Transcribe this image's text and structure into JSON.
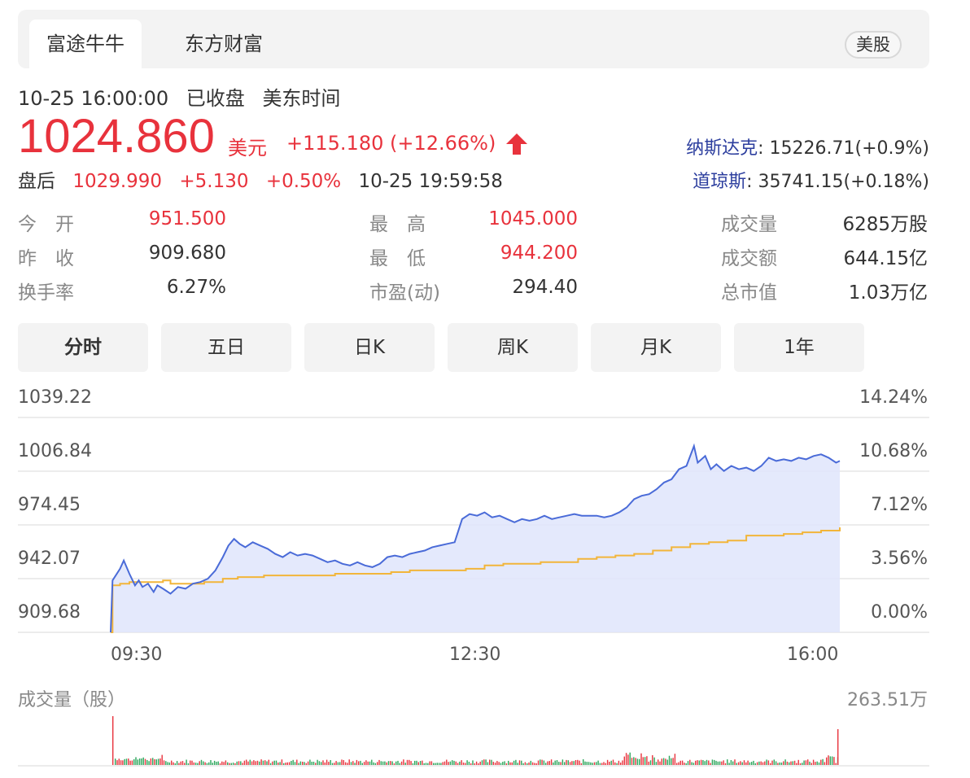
{
  "source_tabs": [
    "富途牛牛",
    "东方财富"
  ],
  "market_badge": "美股",
  "timestamp": "10-25 16:00:00",
  "status": "已收盘",
  "timezone": "美东时间",
  "price": "1024.860",
  "currency": "美元",
  "change": "+115.180 (+12.66%)",
  "indices": [
    {
      "name": "纳斯达克",
      "value": ": 15226.71(+0.9%)"
    },
    {
      "name": "道琼斯",
      "value": ": 35741.15(+0.18%)"
    }
  ],
  "after_hours": {
    "label": "盘后",
    "price": "1029.990",
    "change": "+5.130",
    "percent": "+0.50%",
    "time": "10-25 19:59:58"
  },
  "stats": [
    {
      "label": "今　开",
      "value": "951.500",
      "red": true
    },
    {
      "label": "最　高",
      "value": "1045.000",
      "red": true
    },
    {
      "label": "成交量",
      "value": "6285万股",
      "red": false
    },
    {
      "label": "昨　收",
      "value": "909.680",
      "red": false
    },
    {
      "label": "最　低",
      "value": "944.200",
      "red": true
    },
    {
      "label": "成交额",
      "value": "644.15亿",
      "red": false
    },
    {
      "label": "换手率",
      "value": "6.27%",
      "red": false
    },
    {
      "label": "市盈(动)",
      "value": "294.40",
      "red": false
    },
    {
      "label": "总市值",
      "value": "1.03万亿",
      "red": false
    }
  ],
  "period_tabs": [
    "分时",
    "五日",
    "日K",
    "周K",
    "月K",
    "1年"
  ],
  "active_period": "分时",
  "colors": {
    "up": "#e8323c",
    "down": "#2aa55a",
    "price_line": "#4a6bd8",
    "avg_line": "#f2b53a",
    "fill": "#dfe5fb"
  },
  "chart_data": {
    "type": "line",
    "title": "",
    "y_left_ticks": [
      "1039.22",
      "1006.84",
      "974.45",
      "942.07",
      "909.68"
    ],
    "y_right_ticks": [
      "14.24%",
      "10.68%",
      "7.12%",
      "3.56%",
      "0.00%"
    ],
    "x_ticks": [
      "09:30",
      "12:30",
      "16:00"
    ],
    "ylim": [
      909.68,
      1039.22
    ],
    "x_range_minutes": [
      0,
      390
    ],
    "series": [
      {
        "values": [
          [
            0,
            909.68
          ],
          [
            1,
            941
          ],
          [
            5,
            948
          ],
          [
            7,
            953
          ],
          [
            10,
            945
          ],
          [
            13,
            938
          ],
          [
            15,
            941
          ],
          [
            17,
            937
          ],
          [
            20,
            939
          ],
          [
            23,
            934
          ],
          [
            25,
            938
          ],
          [
            28,
            936
          ],
          [
            32,
            933
          ],
          [
            36,
            937
          ],
          [
            40,
            936
          ],
          [
            44,
            939
          ],
          [
            48,
            940
          ],
          [
            52,
            942
          ],
          [
            56,
            947
          ],
          [
            60,
            955
          ],
          [
            63,
            962
          ],
          [
            66,
            966
          ],
          [
            69,
            963
          ],
          [
            72,
            961
          ],
          [
            76,
            964
          ],
          [
            80,
            962
          ],
          [
            84,
            960
          ],
          [
            88,
            957
          ],
          [
            92,
            955
          ],
          [
            96,
            958
          ],
          [
            100,
            956
          ],
          [
            104,
            957
          ],
          [
            108,
            956
          ],
          [
            112,
            954
          ],
          [
            116,
            952
          ],
          [
            120,
            953
          ],
          [
            124,
            951
          ],
          [
            128,
            950
          ],
          [
            132,
            952
          ],
          [
            136,
            950
          ],
          [
            140,
            949
          ],
          [
            144,
            951
          ],
          [
            148,
            955
          ],
          [
            152,
            956
          ],
          [
            156,
            955
          ],
          [
            160,
            957
          ],
          [
            164,
            958
          ],
          [
            168,
            959
          ],
          [
            172,
            961
          ],
          [
            176,
            962
          ],
          [
            180,
            963
          ],
          [
            184,
            964
          ],
          [
            188,
            978
          ],
          [
            192,
            981
          ],
          [
            196,
            980
          ],
          [
            200,
            982
          ],
          [
            204,
            979
          ],
          [
            208,
            980
          ],
          [
            212,
            978
          ],
          [
            216,
            976
          ],
          [
            220,
            978
          ],
          [
            224,
            977
          ],
          [
            228,
            978
          ],
          [
            232,
            980
          ],
          [
            236,
            978
          ],
          [
            240,
            979
          ],
          [
            244,
            980
          ],
          [
            248,
            981
          ],
          [
            252,
            980
          ],
          [
            256,
            980
          ],
          [
            260,
            980
          ],
          [
            264,
            979
          ],
          [
            268,
            980
          ],
          [
            272,
            982
          ],
          [
            276,
            985
          ],
          [
            280,
            990
          ],
          [
            284,
            992
          ],
          [
            288,
            993
          ],
          [
            292,
            996
          ],
          [
            296,
            1000
          ],
          [
            300,
            1002
          ],
          [
            304,
            1008
          ],
          [
            308,
            1010
          ],
          [
            312,
            1022
          ],
          [
            314,
            1012
          ],
          [
            318,
            1016
          ],
          [
            321,
            1008
          ],
          [
            324,
            1011
          ],
          [
            328,
            1007
          ],
          [
            332,
            1010
          ],
          [
            336,
            1008
          ],
          [
            340,
            1009
          ],
          [
            344,
            1007
          ],
          [
            348,
            1010
          ],
          [
            352,
            1015
          ],
          [
            356,
            1013
          ],
          [
            360,
            1014
          ],
          [
            364,
            1013
          ],
          [
            368,
            1015
          ],
          [
            372,
            1014
          ],
          [
            376,
            1016
          ],
          [
            380,
            1017
          ],
          [
            384,
            1015
          ],
          [
            388,
            1012
          ],
          [
            390,
            1013
          ]
        ]
      },
      {
        "values": [
          [
            0,
            909.68
          ],
          [
            1,
            938
          ],
          [
            5,
            939
          ],
          [
            10,
            940
          ],
          [
            20,
            940
          ],
          [
            28,
            941
          ],
          [
            32,
            939
          ],
          [
            50,
            940
          ],
          [
            60,
            942
          ],
          [
            68,
            943
          ],
          [
            82,
            944
          ],
          [
            100,
            944
          ],
          [
            120,
            945
          ],
          [
            150,
            946
          ],
          [
            160,
            947
          ],
          [
            190,
            948
          ],
          [
            200,
            950
          ],
          [
            210,
            951
          ],
          [
            230,
            952
          ],
          [
            250,
            954
          ],
          [
            260,
            955
          ],
          [
            270,
            956
          ],
          [
            280,
            957
          ],
          [
            290,
            959
          ],
          [
            300,
            961
          ],
          [
            310,
            963
          ],
          [
            320,
            964
          ],
          [
            330,
            965
          ],
          [
            340,
            968
          ],
          [
            350,
            968
          ],
          [
            360,
            969
          ],
          [
            370,
            970
          ],
          [
            380,
            971
          ],
          [
            390,
            973
          ]
        ]
      }
    ]
  },
  "volume": {
    "label": "成交量（股）",
    "max_label": "263.51万"
  }
}
